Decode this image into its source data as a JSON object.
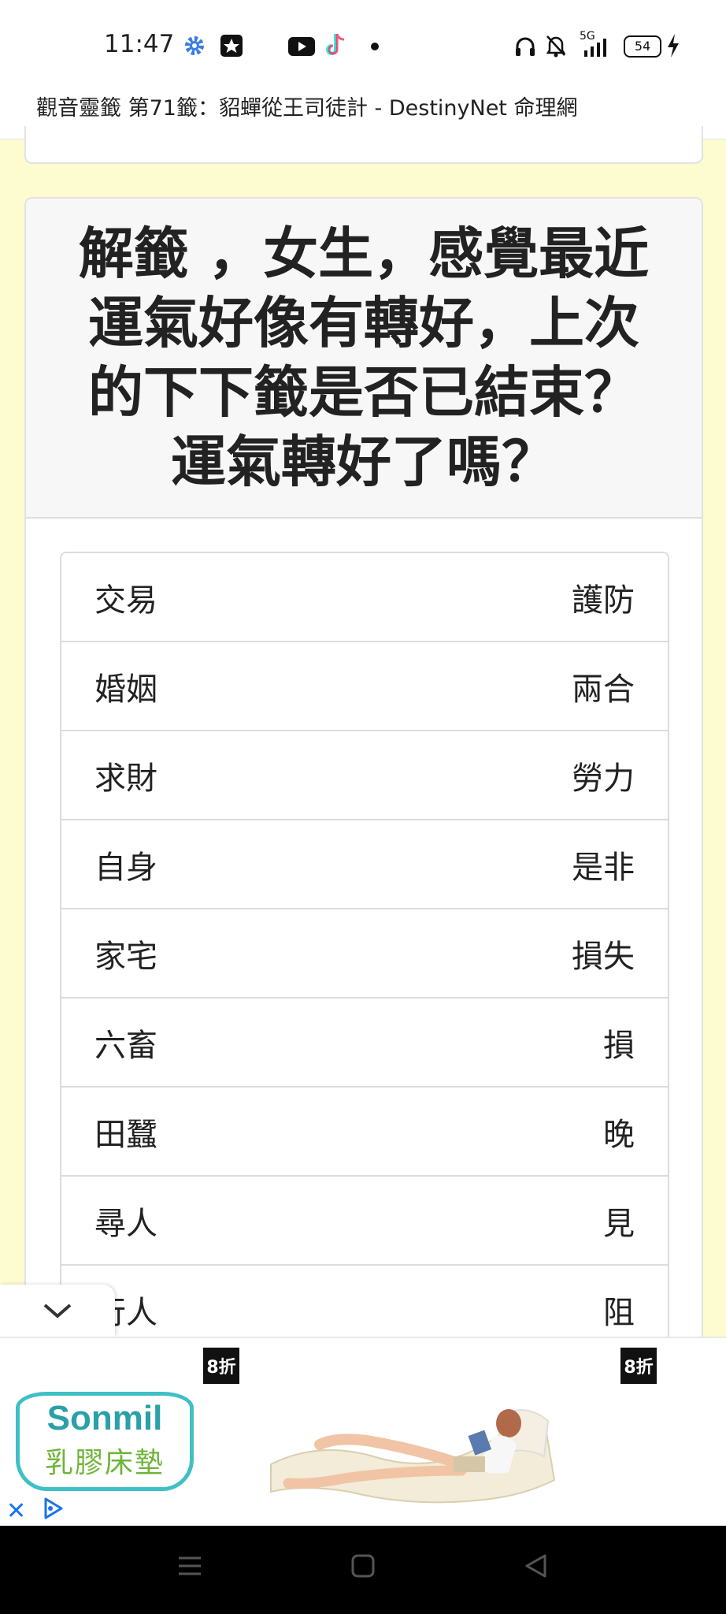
{
  "status_bar": {
    "time": "11:47",
    "network_label": "5G",
    "battery": "54",
    "icons": [
      "settings-gear-icon",
      "star-app-icon",
      "youtube-icon",
      "tiktok-icon",
      "dot-icon",
      "headphones-icon",
      "bell-off-icon",
      "signal-icon",
      "battery-icon",
      "charging-icon"
    ]
  },
  "page": {
    "title": "觀音靈籤 第71籤：貂蟬從王司徒計 - DestinyNet 命理網"
  },
  "card": {
    "title": "解籤 ，女生，感覺最近運氣好像有轉好，上次的下下籤是否已結束？運氣轉好了嗎？"
  },
  "fortune_rows": [
    {
      "category": "交易",
      "result": "護防"
    },
    {
      "category": "婚姻",
      "result": "兩合"
    },
    {
      "category": "求財",
      "result": "勞力"
    },
    {
      "category": "自身",
      "result": "是非"
    },
    {
      "category": "家宅",
      "result": "損失"
    },
    {
      "category": "六畜",
      "result": "損"
    },
    {
      "category": "田蠶",
      "result": "晚"
    },
    {
      "category": "尋人",
      "result": "見"
    },
    {
      "category": "行人",
      "result": "阻"
    }
  ],
  "ad": {
    "brand_name": "Sonmil",
    "brand_sub": "乳膠床墊",
    "discount_left": "8折",
    "discount_right": "8折"
  },
  "colors": {
    "page_background": "#fdfbd0",
    "brand_teal": "#2aa0a8",
    "brand_green": "#6fb43a",
    "ad_choice_blue": "#1a73e8"
  }
}
